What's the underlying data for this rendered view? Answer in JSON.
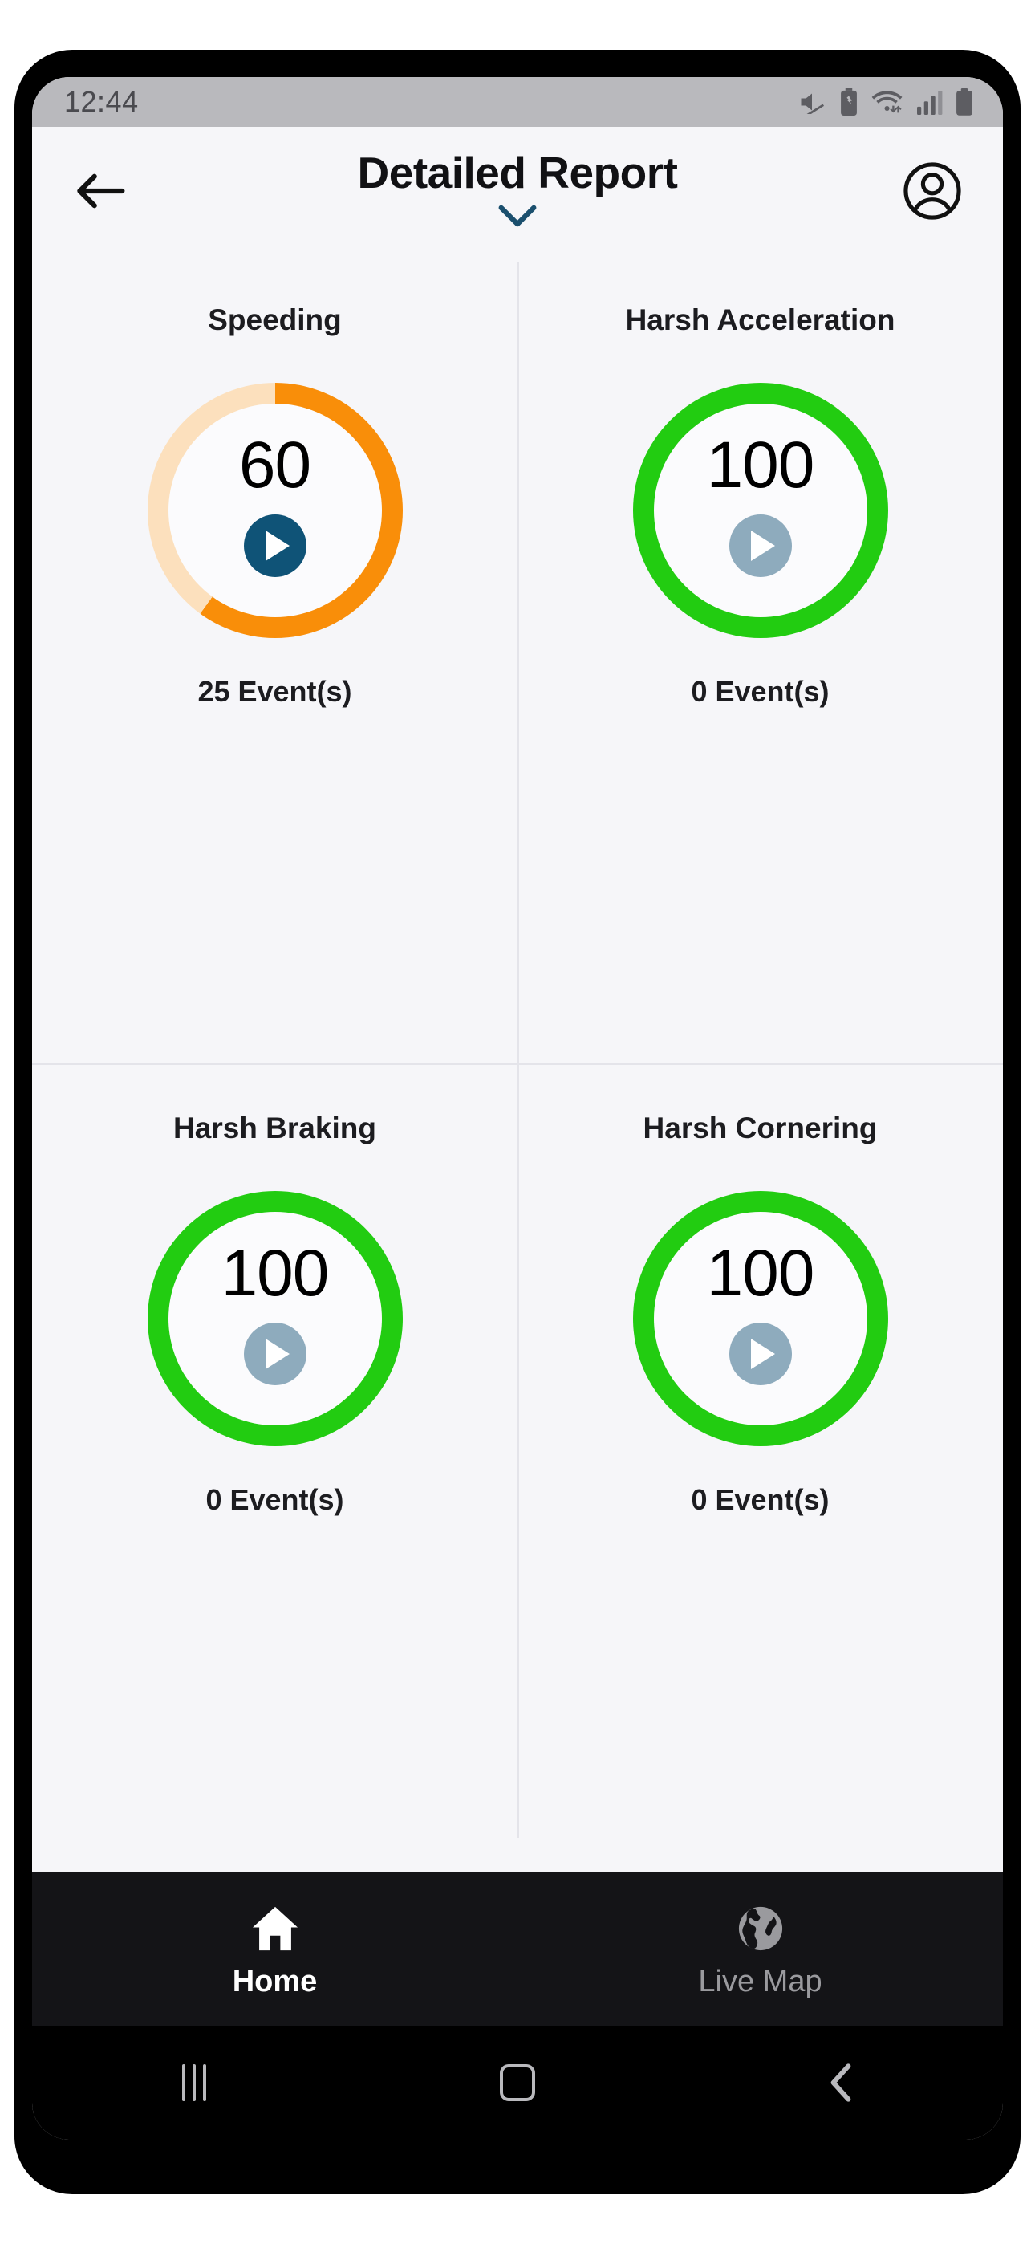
{
  "status_bar": {
    "time": "12:44",
    "icons": [
      "mute-icon",
      "battery-saver-icon",
      "wifi-icon",
      "cellular-signal-icon",
      "battery-icon"
    ]
  },
  "header": {
    "back_icon": "back-arrow-icon",
    "title": "Detailed Report",
    "expand_icon": "chevron-down-icon",
    "account_icon": "account-circle-icon"
  },
  "colors": {
    "speeding_arc": "#F98E09",
    "speeding_track": "#FCE0BD",
    "good_ring": "#22CC11",
    "play_active": "#0F5377",
    "play_disabled": "#8EABBD",
    "accent_chevron": "#1B4F6E",
    "page_bg": "#F6F6F9",
    "divider": "#E4E4EA",
    "nav_bg": "#141417"
  },
  "metrics": [
    {
      "title": "Speeding",
      "score": "60",
      "percent": 60,
      "events": "25 Event(s)",
      "ring_color": "#F98E09",
      "track_color": "#FCE0BD",
      "play_color": "#0F5377",
      "play_icon": "play-icon"
    },
    {
      "title": "Harsh Acceleration",
      "score": "100",
      "percent": 100,
      "events": "0 Event(s)",
      "ring_color": "#22CC11",
      "track_color": "#22CC11",
      "play_color": "#8EABBD",
      "play_icon": "play-icon"
    },
    {
      "title": "Harsh Braking",
      "score": "100",
      "percent": 100,
      "events": "0 Event(s)",
      "ring_color": "#22CC11",
      "track_color": "#22CC11",
      "play_color": "#8EABBD",
      "play_icon": "play-icon"
    },
    {
      "title": "Harsh Cornering",
      "score": "100",
      "percent": 100,
      "events": "0 Event(s)",
      "ring_color": "#22CC11",
      "track_color": "#22CC11",
      "play_color": "#8EABBD",
      "play_icon": "play-icon"
    }
  ],
  "bottom_nav": {
    "items": [
      {
        "label": "Home",
        "icon": "home-icon",
        "active": true
      },
      {
        "label": "Live Map",
        "icon": "globe-icon",
        "active": false
      }
    ]
  },
  "system_bar": {
    "recents_icon": "recents-icon",
    "home_icon": "home-square-icon",
    "back_icon": "back-chevron-icon"
  }
}
